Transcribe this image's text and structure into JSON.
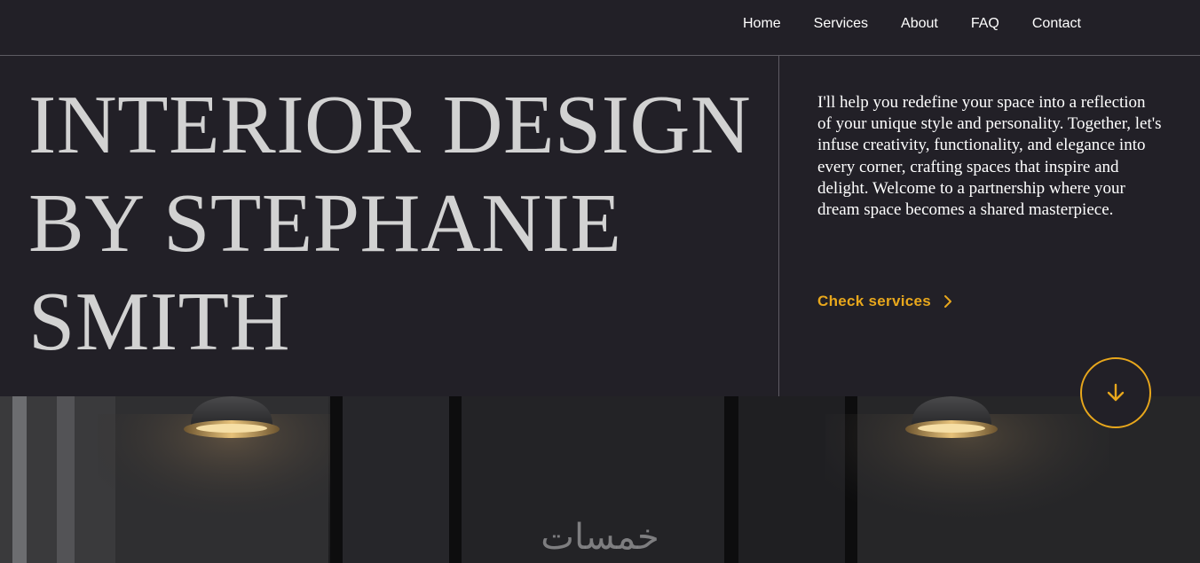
{
  "nav": {
    "items": [
      {
        "label": "Home"
      },
      {
        "label": "Services"
      },
      {
        "label": "About"
      },
      {
        "label": "FAQ"
      },
      {
        "label": "Contact"
      }
    ]
  },
  "hero": {
    "title_lines": [
      "INTERIOR DESIGN",
      "BY STEPHANIE",
      "SMITH"
    ],
    "intro": "I'll help you redefine your space into a reflection of your unique style and personality. Together, let's infuse creativity, functionality, and elegance into every corner, crafting spaces that inspire and delight. Welcome to a partnership where your dream space becomes a shared masterpiece.",
    "cta_label": "Check services",
    "cta_icon": "chevron-right-icon",
    "scroll_icon": "arrow-down-icon"
  },
  "watermark": {
    "text": "خمسات"
  },
  "colors": {
    "background": "#222027",
    "accent": "#e8a71c",
    "title": "#d2d2d2",
    "divider": "#5e5b63"
  }
}
